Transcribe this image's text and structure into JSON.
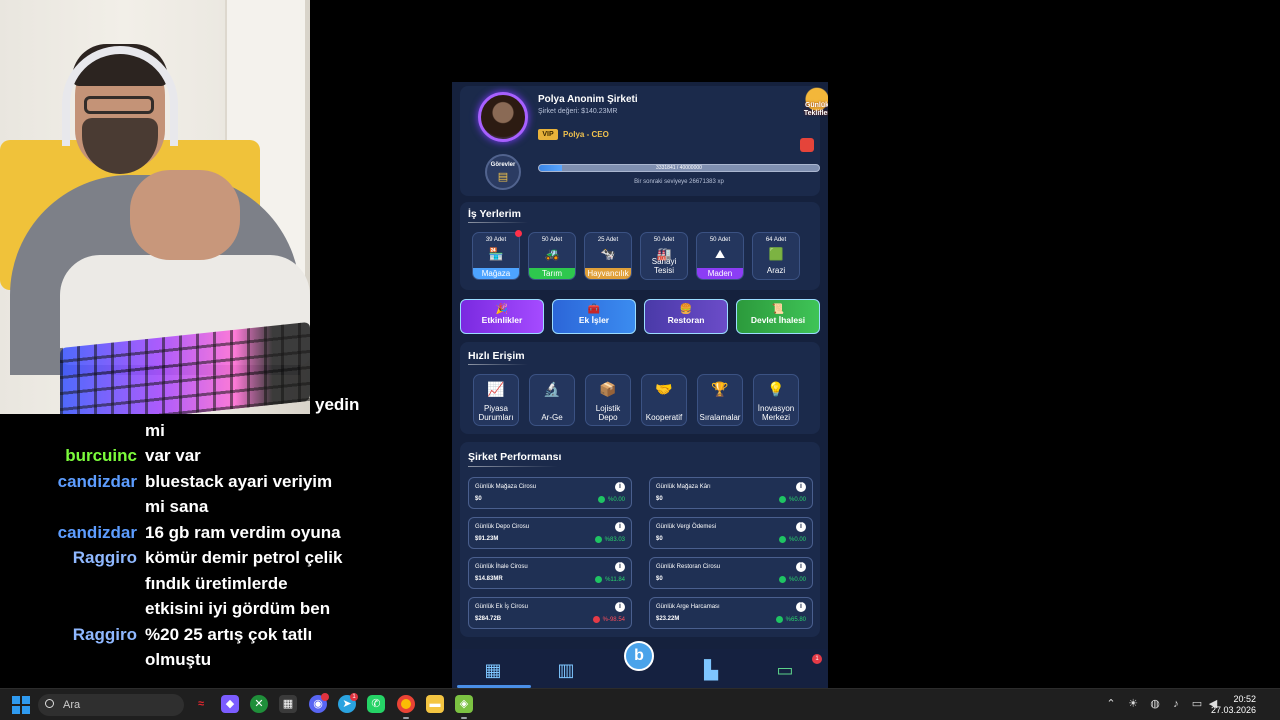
{
  "chat": [
    {
      "user": "",
      "msg": "yedin",
      "user_color": "#ffffff"
    },
    {
      "user": "",
      "msg": "mi",
      "user_color": "#ffffff"
    },
    {
      "user": "burcuinc",
      "msg": "var var",
      "user_color": "#7cfc3c"
    },
    {
      "user": "candizdar",
      "msg": "bluestack ayari veriyim",
      "user_color": "#5d9dff"
    },
    {
      "user": "",
      "msg": "mi sana",
      "user_color": "#ffffff"
    },
    {
      "user": "candizdar",
      "msg": "16 gb ram verdim oyuna",
      "user_color": "#5d9dff"
    },
    {
      "user": "Raggiro",
      "msg": "kömür demir petrol çelik",
      "user_color": "#8fb8ff"
    },
    {
      "user": "",
      "msg": "fındık üretimlerde",
      "user_color": "#ffffff"
    },
    {
      "user": "",
      "msg": "etkisini iyi gördüm ben",
      "user_color": "#ffffff"
    },
    {
      "user": "Raggiro",
      "msg": "%20 25 artış çok tatlı",
      "user_color": "#8fb8ff"
    },
    {
      "user": "",
      "msg": "olmuştu",
      "user_color": "#ffffff"
    }
  ],
  "profile": {
    "company_name": "Polya Anonim Şirketi",
    "company_value": "Şirket değeri: $140.23MR",
    "vip": "VIP",
    "role": "Polya - CEO",
    "tasks_label": "Görevler",
    "daily_offers": "Günlük Teklifler",
    "xp_text": "3331841 / 40000000",
    "xp_fraction": 0.083,
    "next_level": "Bir sonraki seviyeye 26671383 xp"
  },
  "workplaces": {
    "title": "İş Yerlerim",
    "items": [
      {
        "count": "39 Adet",
        "label": "Mağaza",
        "icon": "🏪"
      },
      {
        "count": "50 Adet",
        "label": "Tarım",
        "icon": "🚜"
      },
      {
        "count": "25 Adet",
        "label": "Hayvancılık",
        "icon": "🐄"
      },
      {
        "count": "50 Adet",
        "label": "Sanayi Tesisi",
        "icon": "🏭"
      },
      {
        "count": "50 Adet",
        "label": "Maden",
        "icon": "⛰"
      },
      {
        "count": "64 Adet",
        "label": "Arazi",
        "icon": "🟩"
      }
    ]
  },
  "actions": [
    {
      "label": "Etkinlikler",
      "icon": "🎉"
    },
    {
      "label": "Ek İşler",
      "icon": "🧰"
    },
    {
      "label": "Restoran",
      "icon": "🍔"
    },
    {
      "label": "Devlet İhalesi",
      "icon": "📜"
    }
  ],
  "quick": {
    "title": "Hızlı Erişim",
    "items": [
      {
        "label": "Piyasa Durumları",
        "icon": "📈"
      },
      {
        "label": "Ar-Ge",
        "icon": "🔬"
      },
      {
        "label": "Lojistik Depo",
        "icon": "📦"
      },
      {
        "label": "Kooperatif",
        "icon": "🤝"
      },
      {
        "label": "Sıralamalar",
        "icon": "🏆"
      },
      {
        "label": "İnovasyon Merkezi",
        "icon": "💡"
      }
    ]
  },
  "performance": {
    "title": "Şirket Performansı",
    "items": [
      {
        "title": "Günlük Mağaza Cirosu",
        "value": "$0",
        "pct": "%0.00",
        "neg": false
      },
      {
        "title": "Günlük Mağaza Kârı",
        "value": "$0",
        "pct": "%0.00",
        "neg": false
      },
      {
        "title": "Günlük Depo Cirosu",
        "value": "$91.23M",
        "pct": "%83.03",
        "neg": false
      },
      {
        "title": "Günlük Vergi Ödemesi",
        "value": "$0",
        "pct": "%0.00",
        "neg": false
      },
      {
        "title": "Günlük İhale Cirosu",
        "value": "$14.83MR",
        "pct": "%11.84",
        "neg": false
      },
      {
        "title": "Günlük Restoran Cirosu",
        "value": "$0",
        "pct": "%0.00",
        "neg": false
      },
      {
        "title": "Günlük Ek İş Cirosu",
        "value": "$284.72B",
        "pct": "%-98.54",
        "neg": true
      },
      {
        "title": "Günlük Arge Harcaması",
        "value": "$23.22M",
        "pct": "%65.80",
        "neg": false
      }
    ]
  },
  "taskbar": {
    "search_placeholder": "Ara",
    "time": "20:52",
    "date": "27.03.2026"
  }
}
